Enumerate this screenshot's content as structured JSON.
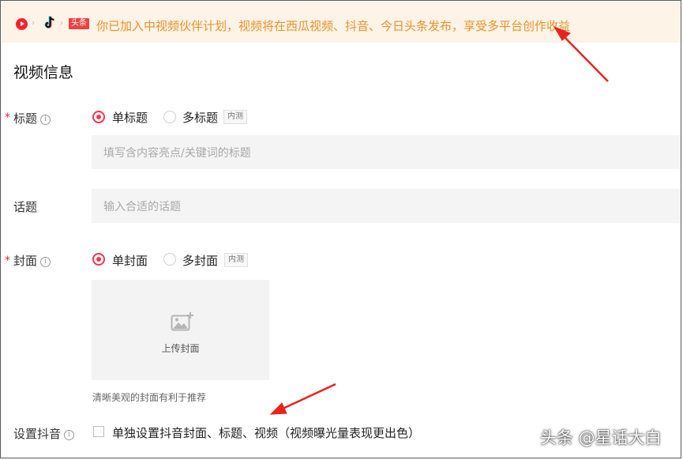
{
  "banner": {
    "toutiao_badge": "头条",
    "separator": "›",
    "text": "你已加入中视频伙伴计划，视频将在西瓜视频、抖音、今日头条发布，享受多平台创作收益",
    "text_color": "#e8932c",
    "background": "#fdf3e6"
  },
  "section_title": "视频信息",
  "title_field": {
    "required_mark": "*",
    "label": "标题",
    "info_glyph": "i",
    "options": [
      {
        "label": "单标题",
        "selected": true
      },
      {
        "label": "多标题",
        "selected": false
      }
    ],
    "beta_tag": "内测",
    "placeholder": "填写含内容亮点/关键词的标题"
  },
  "topic_field": {
    "label": "话题",
    "placeholder": "输入合适的话题"
  },
  "cover_field": {
    "required_mark": "*",
    "label": "封面",
    "info_glyph": "i",
    "options": [
      {
        "label": "单封面",
        "selected": true
      },
      {
        "label": "多封面",
        "selected": false
      }
    ],
    "beta_tag": "内测",
    "upload_label": "上传封面",
    "hint": "清晰美观的封面有利于推荐"
  },
  "douyin_field": {
    "label": "设置抖音",
    "info_glyph": "i",
    "checkbox_label": "单独设置抖音封面、标题、视频（视频曝光量表现更出色）",
    "checked": false
  },
  "watermark": "头条 @星话大白",
  "colors": {
    "accent": "#f5334f",
    "required": "#f5222d",
    "arrow": "#e8231f"
  }
}
